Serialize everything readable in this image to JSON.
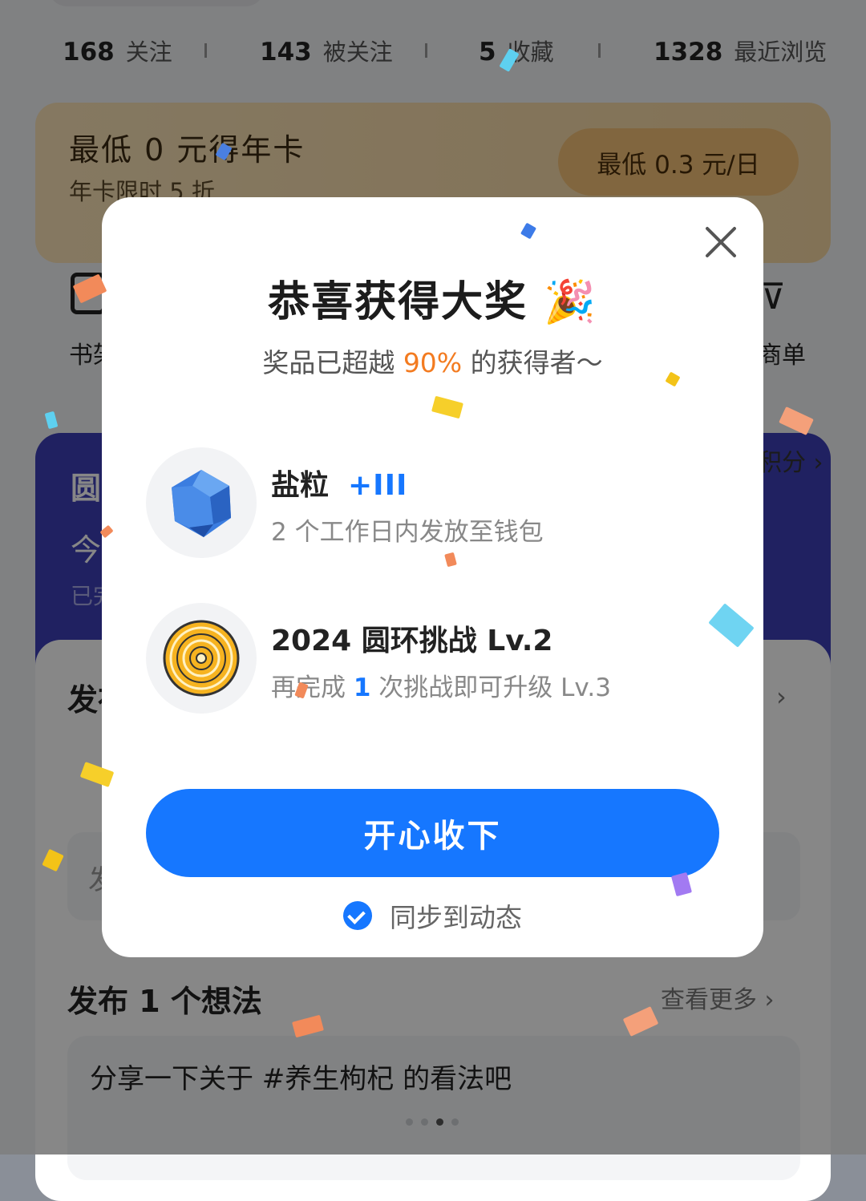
{
  "stats": [
    {
      "num": "168",
      "label": "关注"
    },
    {
      "num": "143",
      "label": "被关注"
    },
    {
      "num": "5",
      "label": "收藏"
    },
    {
      "num": "1328",
      "label": "最近浏览"
    }
  ],
  "vip": {
    "title": "最低 0 元得年卡",
    "subtitle": "年卡限时 5 折",
    "button": "最低 0.3 元/日"
  },
  "shortcuts": {
    "left_partial": "书架",
    "right_partial": "商单"
  },
  "purple_card": {
    "title_partial": "圆",
    "line2_partial": "今",
    "line3_partial": "已完",
    "link_partial": "积分 ›"
  },
  "publish_section": {
    "title_partial": "发布",
    "ghost_partial": "发"
  },
  "ideas": {
    "title": "发布 1 个想法",
    "more": "查看更多",
    "prompt": "分享一下关于 #养生枸杞 的看法吧"
  },
  "modal": {
    "title": "恭喜获得大奖 🎉",
    "subtitle_prefix": "奖品已超越 ",
    "subtitle_highlight": "90%",
    "subtitle_suffix": " 的获得者～",
    "prizes": [
      {
        "name": "盐粒",
        "bonus": "+III",
        "desc": "2 个工作日内发放至钱包",
        "icon": "blue-crystal-icon"
      },
      {
        "name": "2024 圆环挑战 Lv.2",
        "desc_prefix": "再完成 ",
        "desc_highlight": "1",
        "desc_suffix": " 次挑战即可升级 Lv.3",
        "icon": "gold-ring-medal-icon"
      }
    ],
    "confirm_button": "开心收下",
    "sync_label": "同步到动态"
  },
  "colors": {
    "accent": "#1677ff",
    "highlight": "#f37b20",
    "purple": "#3d3fb8",
    "gold": "#f3c178"
  }
}
